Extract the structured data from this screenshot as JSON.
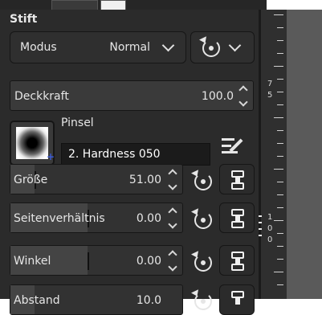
{
  "panel": {
    "title": "Stift"
  },
  "mode": {
    "label": "Modus",
    "value": "Normal"
  },
  "opacity": {
    "label": "Deckkraft",
    "value": "100.0"
  },
  "brush": {
    "heading": "Pinsel",
    "name": "2. Hardness 050"
  },
  "sliders": [
    {
      "label": "Größe",
      "value": "51.00"
    },
    {
      "label": "Seitenverhältnis",
      "value": "0.00"
    },
    {
      "label": "Winkel",
      "value": "0.00"
    },
    {
      "label": "Abstand",
      "value": "10.0"
    }
  ],
  "ruler": {
    "labels": [
      "7",
      "5",
      "1",
      "0",
      "0"
    ]
  },
  "colors": {
    "panel": "#2b2b2b",
    "field_dark": "#1b1b1b",
    "canvas": "#5a5a5a",
    "brush_marker": "#3b5bd6"
  },
  "icons": [
    "chevron-down-icon",
    "reset-icon",
    "spin-up-icon",
    "spin-down-icon",
    "edit-brush-icon",
    "chain-link-icon"
  ]
}
